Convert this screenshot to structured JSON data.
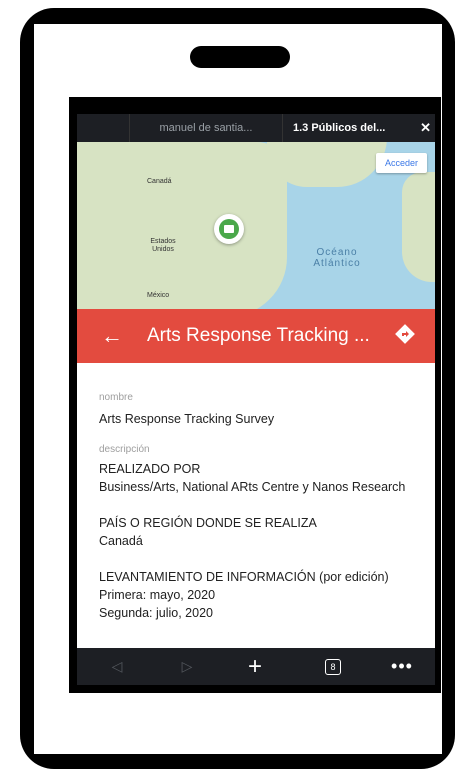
{
  "tabs": {
    "items": [
      {
        "label": ""
      },
      {
        "label": "manuel de santia..."
      },
      {
        "label": "1.3 Públicos del..."
      }
    ],
    "close_glyph": "✕"
  },
  "map": {
    "labels": {
      "canada": "Canadá",
      "usa": "Estados\nUnidos",
      "mexico": "México",
      "ocean": "Océano\nAtlántico"
    },
    "acceder_label": "Acceder"
  },
  "header": {
    "title": "Arts Response Tracking ...",
    "color": "#e34b3f"
  },
  "fields": {
    "nombre_label": "nombre",
    "nombre_value": "Arts Response Tracking Survey",
    "descripcion_label": "descripción",
    "desc_line1": "REALIZADO POR",
    "desc_line2": "Business/Arts, National ARts Centre y Nanos Research",
    "desc_line3": "PAÍS O REGIÓN DONDE SE REALIZA",
    "desc_line4": "Canadá",
    "desc_line5": "LEVANTAMIENTO DE INFORMACIÓN (por edición)",
    "desc_line6": "Primera: mayo, 2020",
    "desc_line7": "Segunda: julio, 2020"
  },
  "bottom_nav": {
    "tab_count": "8"
  }
}
